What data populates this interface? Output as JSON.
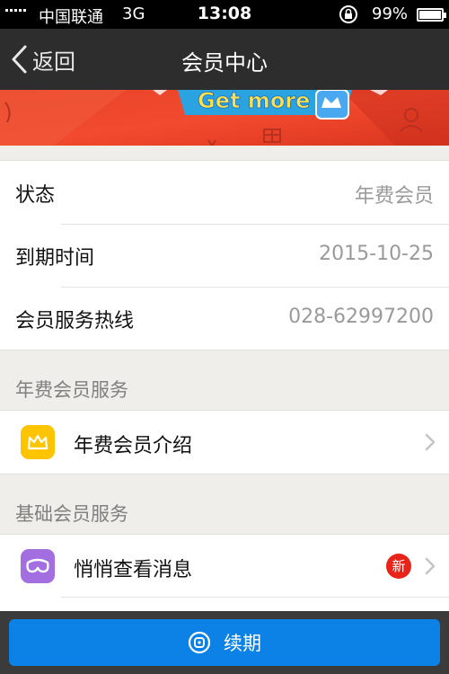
{
  "status_bar": {
    "carrier": "中国联通",
    "network": "3G",
    "time": "13:08",
    "battery": "99%",
    "battery_level": 0.99,
    "icons": [
      "signal-bars-icon",
      "orientation-lock-icon",
      "battery-icon"
    ]
  },
  "nav": {
    "back_label": "返回",
    "title": "会员中心"
  },
  "banner": {
    "text": "Get more"
  },
  "member_info": [
    {
      "label": "状态",
      "value": "年费会员"
    },
    {
      "label": "到期时间",
      "value": "2015-10-25"
    },
    {
      "label": "会员服务热线",
      "value": "028-62997200"
    }
  ],
  "annual_services": {
    "header": "年费会员服务",
    "items": [
      {
        "label": "年费会员介绍",
        "icon": "crown-icon",
        "icon_color": "#ffc400"
      }
    ]
  },
  "basic_services": {
    "header": "基础会员服务",
    "items": [
      {
        "label": "悄悄查看消息",
        "icon": "mask-icon",
        "icon_color": "#a36fe0",
        "badge": "新"
      }
    ]
  },
  "footer": {
    "renew_label": "续期",
    "button_color": "#0c82e6"
  }
}
